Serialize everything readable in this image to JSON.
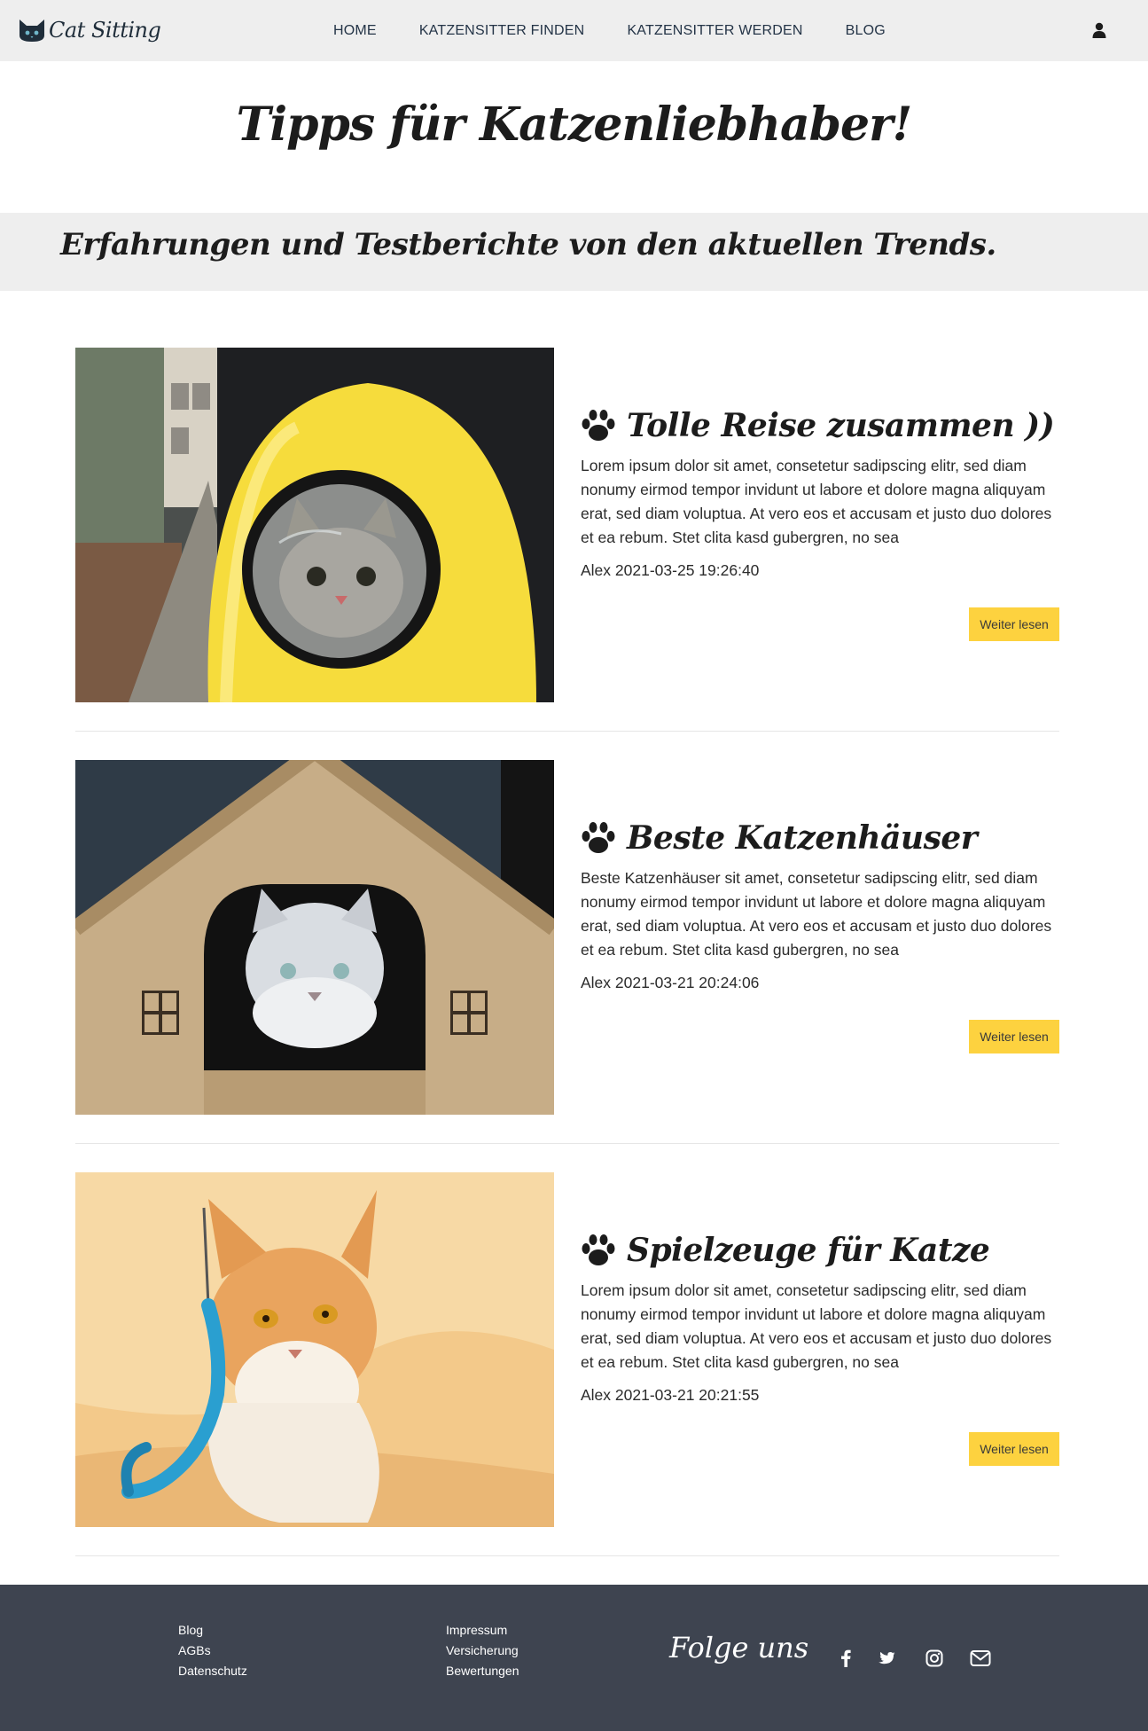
{
  "brand": {
    "name": "Cat Sitting",
    "icon": "cat-face-icon"
  },
  "nav": {
    "items": [
      {
        "label": "HOME"
      },
      {
        "label": "KATZENSITTER FINDEN"
      },
      {
        "label": "KATZENSITTER WERDEN"
      },
      {
        "label": "BLOG"
      }
    ],
    "user_icon": "user-icon"
  },
  "page": {
    "title": "Tipps für Katzenliebhaber!",
    "subtitle": "Erfahrungen und Testberichte von den aktuellen Trends."
  },
  "posts": [
    {
      "title": "Tolle Reise zusammen ))",
      "text": "Lorem ipsum dolor sit amet, consetetur sadipscing elitr, sed diam nonumy eirmod tempor invidunt ut labore et dolore magna aliquyam erat, sed diam voluptua. At vero eos et accusam et justo duo dolores et ea rebum. Stet clita kasd gubergren, no sea",
      "meta": "Alex 2021-03-25 19:26:40",
      "button": "Weiter lesen"
    },
    {
      "title": "Beste Katzenhäuser",
      "text": "Beste Katzenhäuser sit amet, consetetur sadipscing elitr, sed diam nonumy eirmod tempor invidunt ut labore et dolore magna aliquyam erat, sed diam voluptua. At vero eos et accusam et justo duo dolores et ea rebum. Stet clita kasd gubergren, no sea",
      "meta": "Alex 2021-03-21 20:24:06",
      "button": "Weiter lesen"
    },
    {
      "title": "Spielzeuge für Katze",
      "text": "Lorem ipsum dolor sit amet, consetetur sadipscing elitr, sed diam nonumy eirmod tempor invidunt ut labore et dolore magna aliquyam erat, sed diam voluptua. At vero eos et accusam et justo duo dolores et ea rebum. Stet clita kasd gubergren, no sea",
      "meta": "Alex 2021-03-21 20:21:55",
      "button": "Weiter lesen"
    }
  ],
  "footer": {
    "col1": [
      "Blog",
      "AGBs",
      "Datenschutz"
    ],
    "col2": [
      "Impressum",
      "Versicherung",
      "Bewertungen"
    ],
    "follow": "Folge uns",
    "social_icons": [
      "facebook-icon",
      "twitter-icon",
      "instagram-icon",
      "mail-icon"
    ]
  },
  "colors": {
    "nav_bg": "#eeeeee",
    "accent": "#fdd23f",
    "footer_bg": "#3e4450",
    "text": "#222222"
  }
}
